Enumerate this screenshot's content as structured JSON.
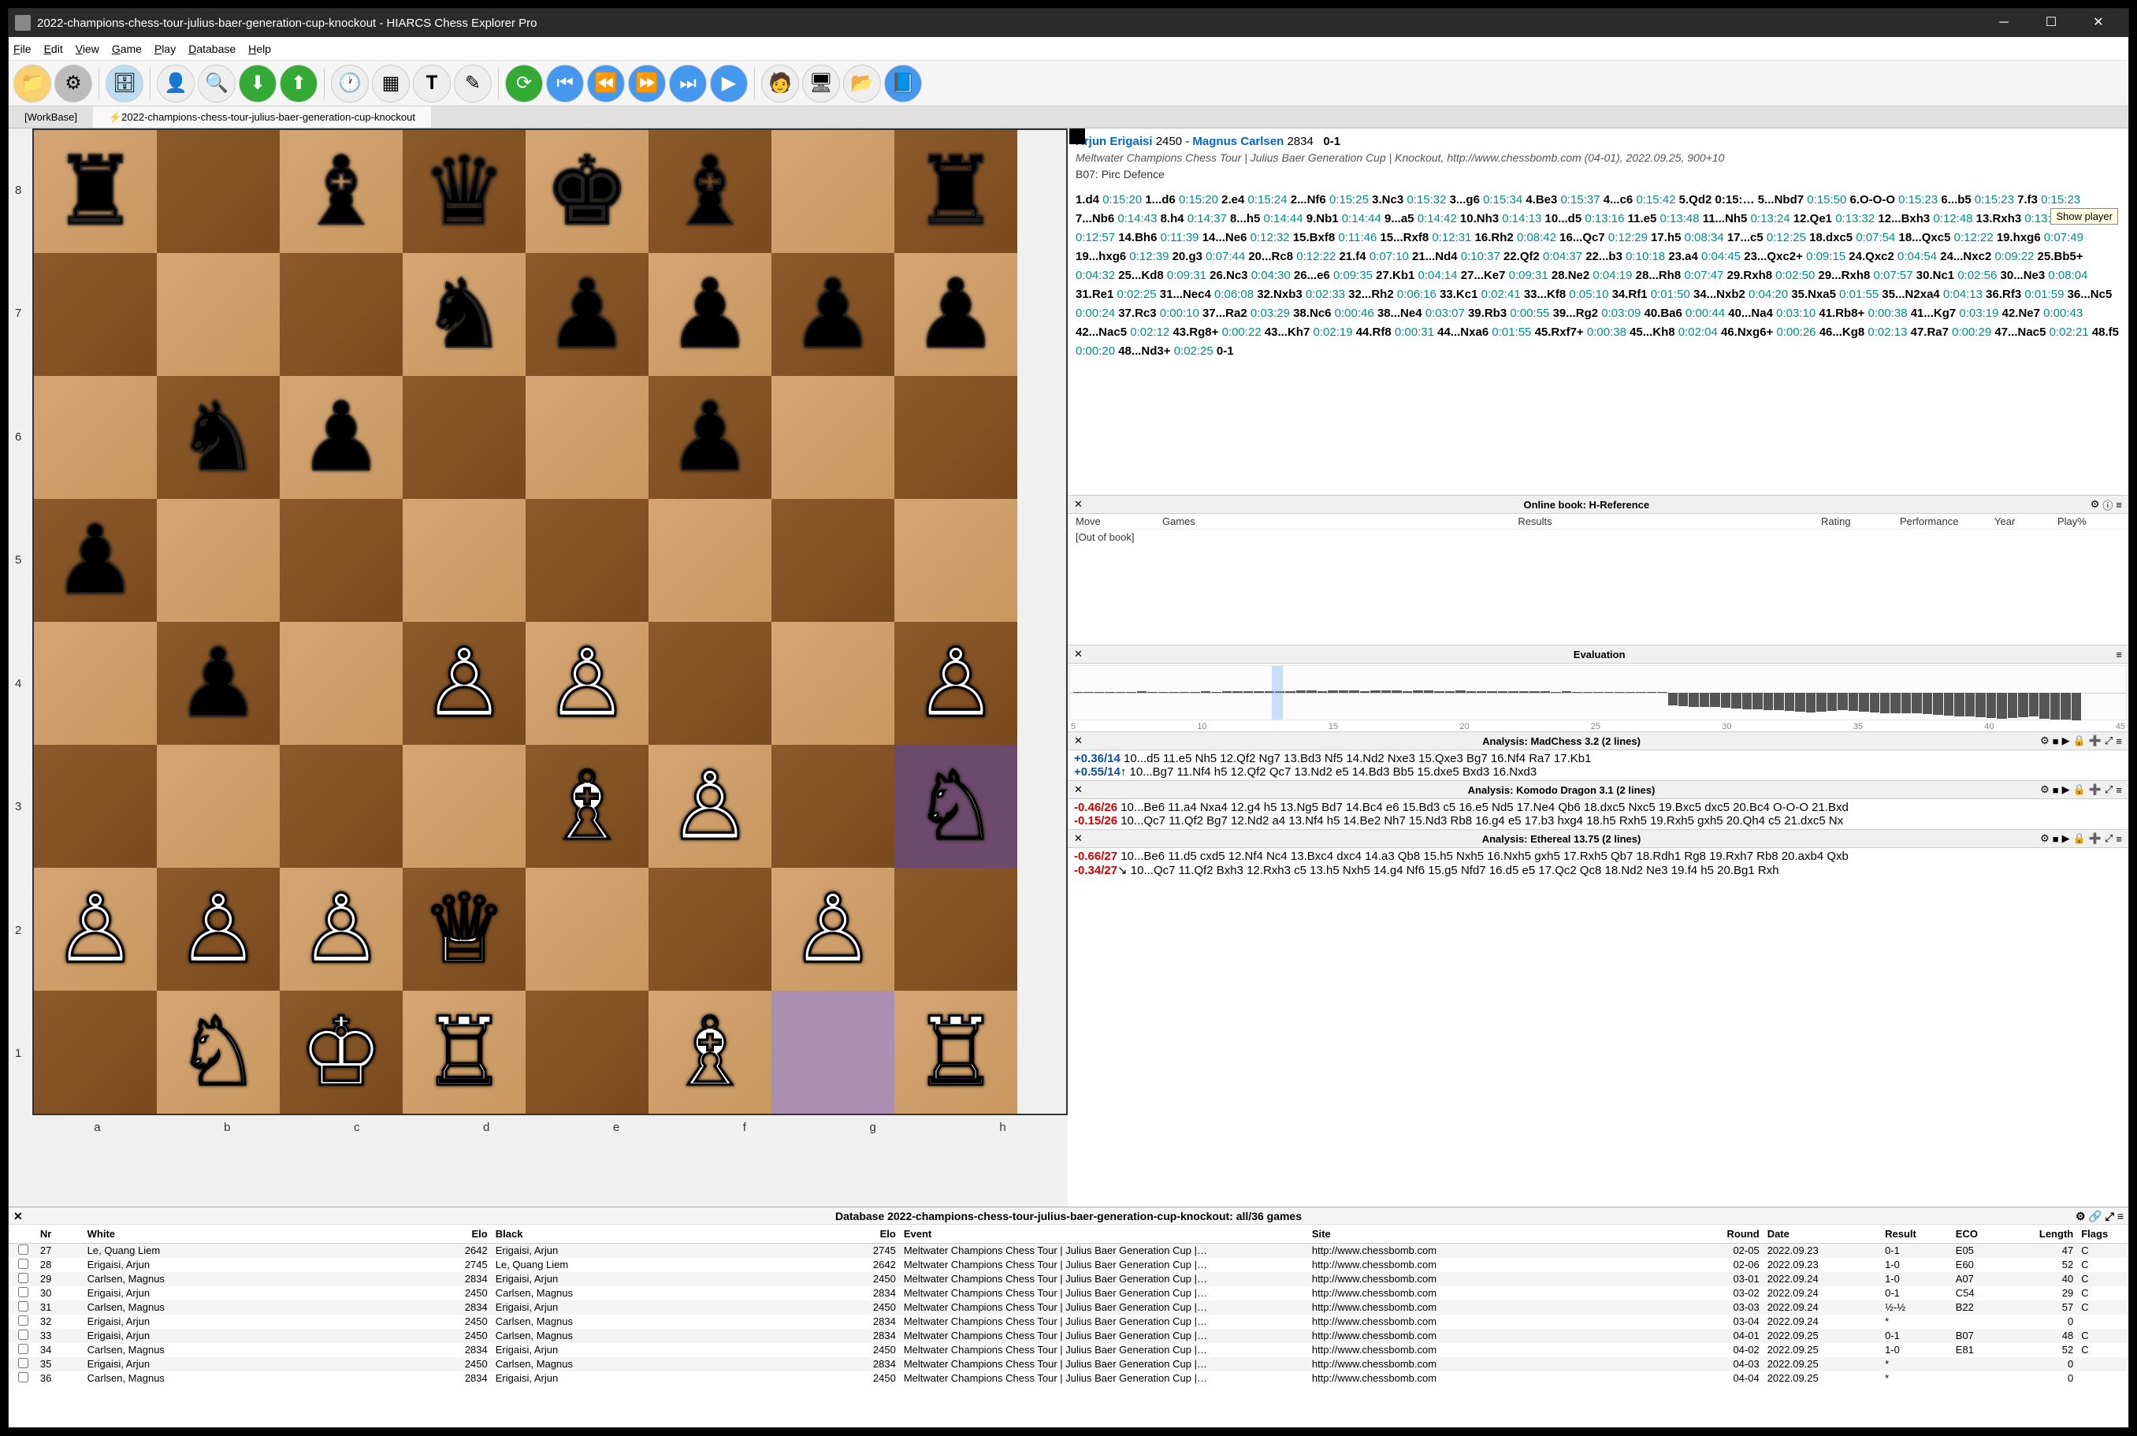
{
  "title": "2022-champions-chess-tour-julius-baer-generation-cup-knockout - HIARCS Chess Explorer Pro",
  "menus": [
    "File",
    "Edit",
    "View",
    "Game",
    "Play",
    "Database",
    "Help"
  ],
  "tabs": {
    "workbase": "[WorkBase]",
    "active": "2022-champions-chess-tour-julius-baer-generation-cup-knockout"
  },
  "tooltip": "Show player",
  "board": {
    "ranks": [
      "8",
      "7",
      "6",
      "5",
      "4",
      "3",
      "2",
      "1"
    ],
    "files": [
      "a",
      "b",
      "c",
      "d",
      "e",
      "f",
      "g",
      "h"
    ],
    "position": [
      [
        "r",
        "",
        "b",
        "q",
        "k",
        "b",
        "",
        "r"
      ],
      [
        "",
        "",
        "",
        "n",
        "p",
        "p",
        "p",
        "p"
      ],
      [
        "",
        "n",
        "p",
        "",
        "",
        "p",
        "",
        "",
        ""
      ],
      [
        "p",
        "",
        "",
        "",
        "",
        "",
        "",
        ""
      ],
      [
        "",
        "p",
        "",
        "P",
        "P",
        "",
        "",
        "P"
      ],
      [
        "",
        "",
        "",
        "",
        "B",
        "P",
        "",
        "N"
      ],
      [
        "P",
        "P",
        "P",
        "Q",
        "",
        "",
        "P",
        ""
      ],
      [
        "",
        "N",
        "K",
        "R",
        "",
        "B",
        "",
        "R"
      ]
    ],
    "fromSquare": "g1",
    "toSquare": "h3"
  },
  "game": {
    "white": "Arjun Erigaisi",
    "whiteElo": "2450",
    "black": "Magnus Carlsen",
    "blackElo": "2834",
    "result": "0-1",
    "event": "Meltwater Champions Chess Tour | Julius Baer Generation Cup | Knockout, http://www.chessbomb.com (04-01), 2022.09.25, 900+10",
    "opening": "B07: Pirc Defence",
    "moves": "1.d4 0:15:20 1...d6 0:15:20 2.e4 0:15:24 2...Nf6 0:15:25 3.Nc3 0:15:32 3...g6 0:15:34 4.Be3 0:15:37 4...c6 0:15:42 5.Qd2 0:15:… 5...Nbd7 0:15:50 6.O-O-O 0:15:23 6...b5 0:15:23 7.f3 0:15:23 7...Nb6 0:14:43 8.h4 0:14:37 8...h5 0:14:44 9.Nb1 0:14:44 9...a5 0:14:42 10.Nh3 0:14:13 10...d5 0:13:16 11.e5 0:13:48 11...Nh5 0:13:24 12.Qe1 0:13:32 12...Bxh3 0:12:48 13.Rxh3 0:13:40 13...Ng7 0:12:57 14.Bh6 0:11:39 14...Ne6 0:12:32 15.Bxf8 0:11:46 15...Rxf8 0:12:31 16.Rh2 0:08:42 16...Qc7 0:12:29 17.h5 0:08:34 17...c5 0:12:25 18.dxc5 0:07:54 18...Qxc5 0:12:22 19.hxg6 0:07:49 19...hxg6 0:12:39 20.g3 0:07:44 20...Rc8 0:12:22 21.f4 0:07:10 21...Nd4 0:10:37 22.Qf2 0:04:37 22...b3 0:10:18 23.a4 0:04:45 23...Qxc2+ 0:09:15 24.Qxc2 0:04:54 24...Nxc2 0:09:22 25.Bb5+ 0:04:32 25...Kd8 0:09:31 26.Nc3 0:04:30 26...e6 0:09:35 27.Kb1 0:04:14 27...Ke7 0:09:31 28.Ne2 0:04:19 28...Rh8 0:07:47 29.Rxh8 0:02:50 29...Rxh8 0:07:57 30.Nc1 0:02:56 30...Ne3 0:08:04 31.Re1 0:02:25 31...Nec4 0:06:08 32.Nxb3 0:02:33 32...Rh2 0:06:16 33.Kc1 0:02:41 33...Kf8 0:05:10 34.Rf1 0:01:50 34...Nxb2 0:04:20 35.Nxa5 0:01:55 35...N2xa4 0:04:13 36.Rf3 0:01:59 36...Nc5 0:00:24 37.Rc3 0:00:10 37...Ra2 0:03:29 38.Nc6 0:00:46 38...Ne4 0:03:07 39.Rb3 0:00:55 39...Rg2 0:03:09 40.Ba6 0:00:44 40...Na4 0:03:10 41.Rb8+ 0:00:38 41...Kg7 0:03:19 42.Ne7 0:00:43 42...Nac5 0:02:12 43.Rg8+ 0:00:22 43...Kh7 0:02:19 44.Rf8 0:00:31 44...Nxa6 0:01:55 45.Rxf7+ 0:00:38 45...Kh8 0:02:04 46.Nxg6+ 0:00:26 46...Kg8 0:02:13 47.Ra7 0:00:29 47...Nac5 0:02:21 48.f5 0:00:20 48...Nd3+ 0:02:25 0-1",
    "currentMove": "10.Nh3"
  },
  "book": {
    "title": "Online book: H-Reference",
    "cols": [
      "Move",
      "Games",
      "Results",
      "Rating",
      "Performance",
      "Year",
      "Play%"
    ],
    "status": "[Out of book]"
  },
  "eval": {
    "title": "Evaluation",
    "bars": [
      2,
      2,
      3,
      2,
      3,
      2,
      4,
      3,
      3,
      3,
      3,
      2,
      4,
      3,
      4,
      5,
      4,
      5,
      4,
      5,
      6,
      7,
      7,
      6,
      7,
      8,
      8,
      6,
      7,
      7,
      7,
      6,
      7,
      7,
      6,
      6,
      7,
      6,
      6,
      6,
      5,
      5,
      4,
      4,
      4,
      3,
      4,
      3,
      3,
      3,
      2,
      3,
      2,
      2,
      2,
      2,
      -40,
      -42,
      -44,
      -45,
      -46,
      -48,
      -50,
      -52,
      -52,
      -54,
      -56,
      -58,
      -60,
      -62,
      -60,
      -58,
      -56,
      -58,
      -60,
      -62,
      -64,
      -66,
      -65,
      -66,
      -68,
      -70,
      -72,
      -74,
      -76,
      -78,
      -80,
      -82,
      -80,
      -78,
      -76,
      -82,
      -84,
      -86,
      -88
    ],
    "ticks": [
      "5",
      "10",
      "15",
      "20",
      "25",
      "30",
      "35",
      "40",
      "45"
    ],
    "cursorIndex": 19
  },
  "engines": [
    {
      "name": "Analysis: MadChess 3.2 (2 lines)",
      "lines": [
        {
          "score": "+0.36/14",
          "pv": "10...d5 11.e5 Nh5 12.Qf2 Ng7 13.Bd3 Nf5 14.Nd2 Nxe3 15.Qxe3 Bg7 16.Nf4 Ra7 17.Kb1"
        },
        {
          "score": "+0.55/14",
          "sym": "↑",
          "pv": "10...Bg7 11.Nf4 h5 12.Qf2 Qc7 13.Nd2 e5 14.Bd3 Bb5 15.dxe5 Bxd3 16.Nxd3"
        }
      ]
    },
    {
      "name": "Analysis: Komodo Dragon 3.1 (2 lines)",
      "lines": [
        {
          "score": "-0.46/26",
          "pv": "10...Be6 11.a4 Nxa4 12.g4 h5 13.Ng5 Bd7 14.Bc4 e6 15.Bd3 c5 16.e5 Nd5 17.Ne4 Qb6 18.dxc5 Nxc5 19.Bxc5 dxc5 20.Bc4 O-O-O 21.Bxd"
        },
        {
          "score": "-0.15/26",
          "pv": "10...Qc7 11.Qf2 Bg7 12.Nd2 a4 13.Nf4 h5 14.Be2 Nh7 15.Nd3 Rb8 16.g4 e5 17.b3 hxg4 18.h5 Rxh5 19.Rxh5 gxh5 20.Qh4 c5 21.dxc5 Nx"
        }
      ]
    },
    {
      "name": "Analysis: Ethereal 13.75 (2 lines)",
      "lines": [
        {
          "score": "-0.66/27",
          "pv": "10...Be6 11.d5 cxd5 12.Nf4 Nc4 13.Bxc4 dxc4 14.a3 Qb8 15.h5 Nxh5 16.Nxh5 gxh5 17.Rxh5 Qb7 18.Rdh1 Rg8 19.Rxh7 Rb8 20.axb4 Qxb"
        },
        {
          "score": "-0.34/27",
          "sym": "↘",
          "pv": "10...Qc7 11.Qf2 Bxh3 12.Rxh3 c5 13.h5 Nxh5 14.g4 Nf6 15.g5 Nfd7 16.d5 e5 17.Qc2 Qc8 18.Nd2 Ne3 19.f4 h5 20.Bg1 Rxh"
        }
      ]
    }
  ],
  "database": {
    "title": "Database 2022-champions-chess-tour-julius-baer-generation-cup-knockout: all/36 games",
    "headers": [
      "Nr",
      "White",
      "Elo",
      "Black",
      "Elo",
      "Event",
      "Site",
      "Round",
      "Date",
      "Result",
      "ECO",
      "Length",
      "Flags"
    ],
    "games": [
      {
        "nr": "27",
        "w": "Le, Quang Liem",
        "we": "2642",
        "b": "Erigaisi, Arjun",
        "be": "2745",
        "ev": "Meltwater Champions Chess Tour | Julius Baer Generation Cup |…",
        "site": "http://www.chessbomb.com",
        "rd": "02-05",
        "dt": "2022.09.23",
        "res": "0-1",
        "eco": "E05",
        "len": "47",
        "fl": "C"
      },
      {
        "nr": "28",
        "w": "Erigaisi, Arjun",
        "we": "2745",
        "b": "Le, Quang Liem",
        "be": "2642",
        "ev": "Meltwater Champions Chess Tour | Julius Baer Generation Cup |…",
        "site": "http://www.chessbomb.com",
        "rd": "02-06",
        "dt": "2022.09.23",
        "res": "1-0",
        "eco": "E60",
        "len": "52",
        "fl": "C"
      },
      {
        "nr": "29",
        "w": "Carlsen, Magnus",
        "we": "2834",
        "b": "Erigaisi, Arjun",
        "be": "2450",
        "ev": "Meltwater Champions Chess Tour | Julius Baer Generation Cup |…",
        "site": "http://www.chessbomb.com",
        "rd": "03-01",
        "dt": "2022.09.24",
        "res": "1-0",
        "eco": "A07",
        "len": "40",
        "fl": "C"
      },
      {
        "nr": "30",
        "w": "Erigaisi, Arjun",
        "we": "2450",
        "b": "Carlsen, Magnus",
        "be": "2834",
        "ev": "Meltwater Champions Chess Tour | Julius Baer Generation Cup |…",
        "site": "http://www.chessbomb.com",
        "rd": "03-02",
        "dt": "2022.09.24",
        "res": "0-1",
        "eco": "C54",
        "len": "29",
        "fl": "C"
      },
      {
        "nr": "31",
        "w": "Carlsen, Magnus",
        "we": "2834",
        "b": "Erigaisi, Arjun",
        "be": "2450",
        "ev": "Meltwater Champions Chess Tour | Julius Baer Generation Cup |…",
        "site": "http://www.chessbomb.com",
        "rd": "03-03",
        "dt": "2022.09.24",
        "res": "½-½",
        "eco": "B22",
        "len": "57",
        "fl": "C"
      },
      {
        "nr": "32",
        "w": "Erigaisi, Arjun",
        "we": "2450",
        "b": "Carlsen, Magnus",
        "be": "2834",
        "ev": "Meltwater Champions Chess Tour | Julius Baer Generation Cup |…",
        "site": "http://www.chessbomb.com",
        "rd": "03-04",
        "dt": "2022.09.24",
        "res": "*",
        "eco": "",
        "len": "0",
        "fl": ""
      },
      {
        "nr": "33",
        "w": "Erigaisi, Arjun",
        "we": "2450",
        "b": "Carlsen, Magnus",
        "be": "2834",
        "ev": "Meltwater Champions Chess Tour | Julius Baer Generation Cup |…",
        "site": "http://www.chessbomb.com",
        "rd": "04-01",
        "dt": "2022.09.25",
        "res": "0-1",
        "eco": "B07",
        "len": "48",
        "fl": "C"
      },
      {
        "nr": "34",
        "w": "Carlsen, Magnus",
        "we": "2834",
        "b": "Erigaisi, Arjun",
        "be": "2450",
        "ev": "Meltwater Champions Chess Tour | Julius Baer Generation Cup |…",
        "site": "http://www.chessbomb.com",
        "rd": "04-02",
        "dt": "2022.09.25",
        "res": "1-0",
        "eco": "E81",
        "len": "52",
        "fl": "C"
      },
      {
        "nr": "35",
        "w": "Erigaisi, Arjun",
        "we": "2450",
        "b": "Carlsen, Magnus",
        "be": "2834",
        "ev": "Meltwater Champions Chess Tour | Julius Baer Generation Cup |…",
        "site": "http://www.chessbomb.com",
        "rd": "04-03",
        "dt": "2022.09.25",
        "res": "*",
        "eco": "",
        "len": "0",
        "fl": ""
      },
      {
        "nr": "36",
        "w": "Carlsen, Magnus",
        "we": "2834",
        "b": "Erigaisi, Arjun",
        "be": "2450",
        "ev": "Meltwater Champions Chess Tour | Julius Baer Generation Cup |…",
        "site": "http://www.chessbomb.com",
        "rd": "04-04",
        "dt": "2022.09.25",
        "res": "*",
        "eco": "",
        "len": "0",
        "fl": ""
      }
    ]
  }
}
